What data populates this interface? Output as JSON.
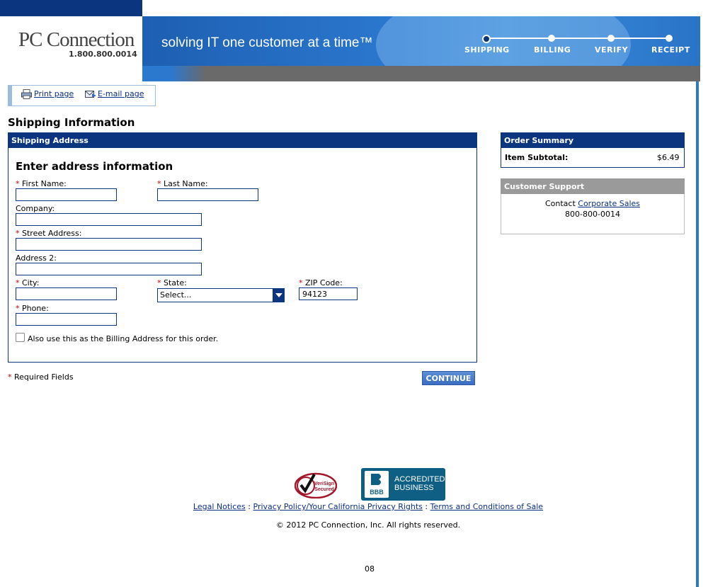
{
  "header": {
    "logo_text": "PC Connection",
    "logo_phone": "1.800.800.0014",
    "tagline": "solving IT one customer at a time™",
    "steps": [
      {
        "label": "SHIPPING",
        "active": true
      },
      {
        "label": "BILLING",
        "active": false
      },
      {
        "label": "VERIFY",
        "active": false
      },
      {
        "label": "RECEIPT",
        "active": false
      }
    ]
  },
  "utility": {
    "print_label": "Print page",
    "email_label": "E-mail page"
  },
  "page_title": "Shipping Information",
  "shipping_panel": {
    "header": "Shipping Address",
    "section_title": "Enter address information",
    "required_marker": "*",
    "first_name": {
      "label": "First Name:",
      "value": ""
    },
    "last_name": {
      "label": "Last Name:",
      "value": ""
    },
    "company": {
      "label": "Company:",
      "value": ""
    },
    "street": {
      "label": "Street Address:",
      "value": ""
    },
    "address2": {
      "label": "Address 2:",
      "value": ""
    },
    "city": {
      "label": "City:",
      "value": ""
    },
    "state": {
      "label": "State:",
      "selected": "Select..."
    },
    "zip": {
      "label": "ZIP Code:",
      "value": "94123"
    },
    "phone": {
      "label": "Phone:",
      "value": ""
    },
    "billing_checkbox_label": "Also use this as the Billing Address for this order."
  },
  "required_note": "Required Fields",
  "continue_label": "CONTINUE",
  "order_summary": {
    "header": "Order Summary",
    "subtotal_label": "Item Subtotal:",
    "subtotal_value": "$6.49"
  },
  "customer_support": {
    "header": "Customer Support",
    "contact_prefix": "Contact",
    "contact_link": "Corporate Sales",
    "phone": "800-800-0014"
  },
  "footer": {
    "verisign_label": "VeriSign Secured",
    "bbb_label_1": "ACCREDITED",
    "bbb_label_2": "BUSINESS",
    "bbb_mark": "BBB",
    "links": [
      "Legal Notices",
      "Privacy Policy/Your California Privacy Rights",
      "Terms and Conditions of Sale"
    ],
    "separator": ":",
    "copyright": "© 2012 PC Connection, Inc. All rights reserved.",
    "page_number": "08"
  },
  "colors": {
    "navy": "#0c3580",
    "banner_blue": "#2b78cf",
    "required_red": "#cc0000"
  }
}
